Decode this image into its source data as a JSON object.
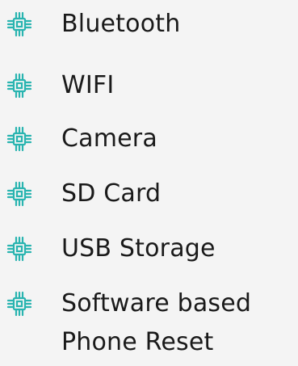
{
  "colors": {
    "background": "#f4f4f4",
    "icon": "#29b4b0",
    "text": "#1a1a1a"
  },
  "features": [
    {
      "label": "Bluetooth",
      "icon": "chip-icon"
    },
    {
      "label": "WIFI",
      "icon": "chip-icon"
    },
    {
      "label": "Camera",
      "icon": "chip-icon"
    },
    {
      "label": "SD Card",
      "icon": "chip-icon"
    },
    {
      "label": "USB Storage",
      "icon": "chip-icon"
    },
    {
      "label_line1": "Software based",
      "label_line2": "Phone Reset",
      "icon": "chip-icon"
    }
  ]
}
